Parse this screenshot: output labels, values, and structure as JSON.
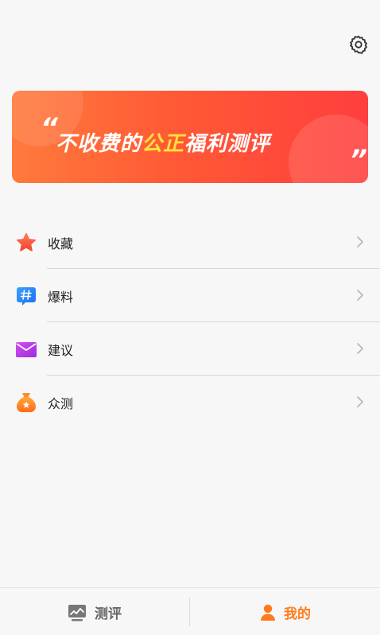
{
  "header": {
    "settings_icon": "gear-icon"
  },
  "banner": {
    "quote_open": "“",
    "slogan_part1": "不收费的",
    "slogan_highlight": "公正",
    "slogan_part2": "福利测评",
    "quote_close": "”",
    "colors": {
      "gradient_start": "#ff7a3c",
      "gradient_end": "#ff3e3e",
      "highlight": "#ffe23d"
    }
  },
  "menu": {
    "items": [
      {
        "label": "收藏",
        "icon": "star-icon"
      },
      {
        "label": "爆料",
        "icon": "hashtag-icon"
      },
      {
        "label": "建议",
        "icon": "mail-icon"
      },
      {
        "label": "众测",
        "icon": "money-bag-icon"
      }
    ]
  },
  "tabbar": {
    "tabs": [
      {
        "label": "测评",
        "icon": "review-chart-icon",
        "active": false
      },
      {
        "label": "我的",
        "icon": "user-icon",
        "active": true
      }
    ],
    "active_color": "#ff7a1a",
    "inactive_color": "#666666"
  }
}
